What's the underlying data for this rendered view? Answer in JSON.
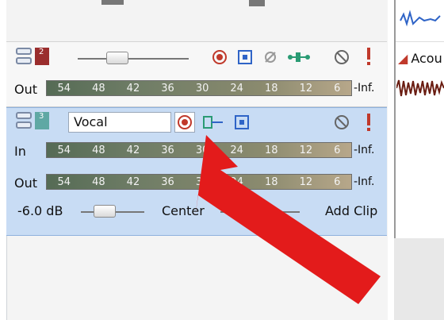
{
  "tracks": {
    "track2": {
      "number": "2",
      "out_label": "Out",
      "meter_ticks": [
        "54",
        "48",
        "42",
        "36",
        "30",
        "24",
        "18",
        "12",
        "6"
      ],
      "inf_label": "-Inf."
    },
    "track3": {
      "number": "3",
      "name": "Vocal",
      "in_label": "In",
      "out_label": "Out",
      "meter_ticks": [
        "54",
        "48",
        "42",
        "36",
        "30",
        "24",
        "18",
        "12",
        "6"
      ],
      "inf_label": "-Inf.",
      "volume": "-6.0 dB",
      "pan": "Center",
      "add_clip_label": "Add Clip"
    }
  },
  "right_pane": {
    "clip_label": "Acou"
  },
  "colors": {
    "accent_red": "#e31b1b",
    "selected_bg": "#c8dcf4",
    "record_red": "#c0392b",
    "toolbar_blue": "#2f64c7",
    "green": "#2a9b74"
  },
  "icons": [
    "track-icon",
    "arm-record-icon",
    "input-monitor-icon",
    "fx-icon",
    "mute-icon",
    "solo-icon",
    "automation-icon",
    "pointer-arrow-icon"
  ]
}
